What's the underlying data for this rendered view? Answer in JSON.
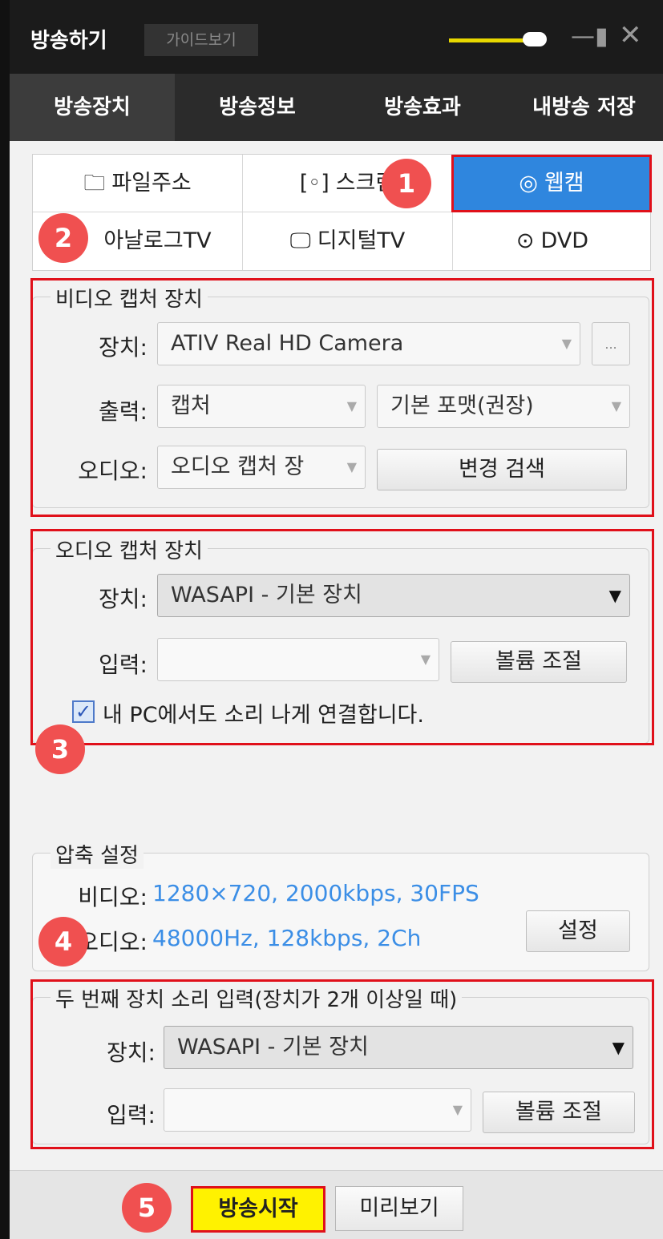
{
  "window": {
    "title": "방송하기",
    "guide_label": "가이드보기",
    "volume_level": 0.85
  },
  "tabs": [
    "방송장치",
    "방송정보",
    "방송효과",
    "내방송 저장"
  ],
  "sources": {
    "file": "파일주소",
    "screen": "스크린",
    "webcam": "웹캠",
    "analog": "아날로그TV",
    "digital": "디지털TV",
    "dvd": "DVD"
  },
  "video_capture": {
    "title": "비디오 캡처 장치",
    "device_label": "장치:",
    "device_value": "ATIV Real HD Camera",
    "more_label": "...",
    "output_label": "출력:",
    "output_value": "캡처",
    "format_value": "기본 포맷(권장)",
    "audio_label": "오디오:",
    "audio_value": "오디오 캡처 장",
    "change_search_label": "변경 검색"
  },
  "audio_capture": {
    "title": "오디오 캡처 장치",
    "device_label": "장치:",
    "device_value": "WASAPI - 기본 장치",
    "input_label": "입력:",
    "input_value": "",
    "volume_button": "볼륨 조절",
    "checkbox_label": "내 PC에서도 소리 나게 연결합니다.",
    "checkbox_checked": true
  },
  "compression": {
    "title": "압축 설정",
    "video_label": "비디오:",
    "video_value": "1280×720, 2000kbps, 30FPS",
    "audio_label": "오디오:",
    "audio_value": "48000Hz, 128kbps, 2Ch",
    "settings_button": "설정"
  },
  "second_device": {
    "title": "두 번째 장치 소리 입력(장치가 2개 이상일 때)",
    "device_label": "장치:",
    "device_value": "WASAPI - 기본 장치",
    "input_label": "입력:",
    "input_value": "",
    "volume_button": "볼륨 조절"
  },
  "footer": {
    "start_label": "방송시작",
    "preview_label": "미리보기"
  },
  "markers": [
    "1",
    "2",
    "3",
    "4",
    "5"
  ],
  "colors": {
    "highlight_red": "#e0101a",
    "webcam_selected": "#2f86de",
    "marker": "#f05050",
    "start_button": "#fff200",
    "info_blue": "#3b8ee6"
  }
}
